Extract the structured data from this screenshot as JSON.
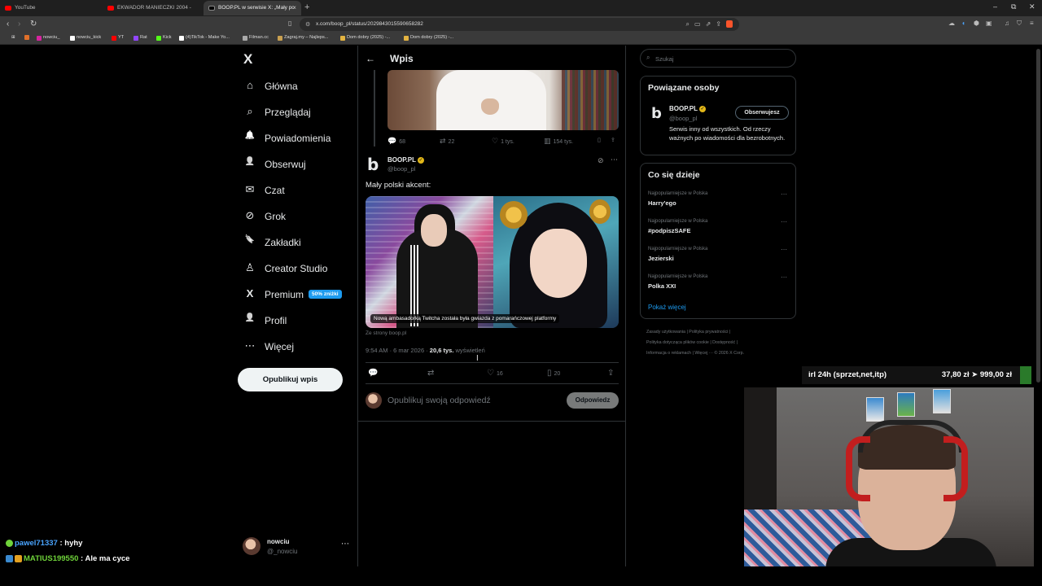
{
  "browser": {
    "tabs": [
      {
        "label": "YouTube",
        "active": false
      },
      {
        "label": "EKWADOR MANIECZKI 2004 -",
        "active": false
      },
      {
        "label": "BOOP.PL w serwisie X: „Mały po",
        "active": true
      }
    ],
    "url": "x.com/boop_pl/status/2029843015590658282",
    "bookmarks": [
      "nowciu_",
      "nowciu_kick",
      "YT",
      "Rat",
      "Kick",
      "(4)TikTok - Make Yo...",
      "Filman.cc",
      "Zagraj.my – Najleps...",
      "Dom dobry (2025) -...",
      "Dom dobry (2025) -..."
    ],
    "colors": {
      "chrome_bg": "#3a3a3a",
      "tabbar_bg": "#1f1f1f"
    }
  },
  "nav": {
    "logo": "X",
    "items": [
      {
        "label": "Główna",
        "icon": "home-icon",
        "glyph": "⌂"
      },
      {
        "label": "Przeglądaj",
        "icon": "search-icon",
        "glyph": "⌕"
      },
      {
        "label": "Powiadomienia",
        "icon": "bell-icon",
        "glyph": "🔔"
      },
      {
        "label": "Obserwuj",
        "icon": "follow-icon",
        "glyph": "👤"
      },
      {
        "label": "Czat",
        "icon": "mail-icon",
        "glyph": "✉"
      },
      {
        "label": "Grok",
        "icon": "grok-icon",
        "glyph": "⊘"
      },
      {
        "label": "Zakładki",
        "icon": "bookmark-icon",
        "glyph": "🔖"
      },
      {
        "label": "Creator Studio",
        "icon": "creator-icon",
        "glyph": "♙"
      },
      {
        "label": "Premium",
        "icon": "x-premium-icon",
        "glyph": "X"
      },
      {
        "label": "Profil",
        "icon": "profile-icon",
        "glyph": "👤"
      },
      {
        "label": "Więcej",
        "icon": "more-icon",
        "glyph": "⋯"
      }
    ],
    "premium_badge": "50% zniżki",
    "post_button": "Opublikuj wpis",
    "account": {
      "name": "nowciu",
      "handle": "@_nowciu"
    }
  },
  "main": {
    "header_title": "Wpis",
    "prev_post_actions": {
      "replies": "68",
      "reposts": "22",
      "likes": "1 tys.",
      "views": "154 tys."
    },
    "post": {
      "author": "BOOP.PL",
      "handle": "@boop_pl",
      "text": "Mały polski akcent:",
      "image_caption": "Nową ambasadorką Twitcha została była gwiazda z pomarańczowej platformy",
      "source": "Ze strony boop.pl",
      "time": "9:54 AM · 6 mar 2026 · ",
      "views_count": "20,6 tys.",
      "views_label": " wyświetleń",
      "actions": {
        "replies": "",
        "reposts": "",
        "likes": "16",
        "bookmarks": "20"
      }
    },
    "reply": {
      "placeholder": "Opublikuj swoją odpowiedź",
      "button": "Odpowiedz"
    }
  },
  "sidebar": {
    "search_placeholder": "Szukaj",
    "related": {
      "title": "Powiązane osoby",
      "name": "BOOP.PL",
      "handle": "@boop_pl",
      "bio": "Serwis inny od wszystkich. Od rzeczy ważnych po wiadomości dla bezrobotnych.",
      "follow_button": "Obserwujesz"
    },
    "trends": {
      "title": "Co się dzieje",
      "items": [
        {
          "context": "Najpopularniejsze w Polska",
          "name": "Harry'ego"
        },
        {
          "context": "Najpopularniejsze w Polska",
          "name": "#podpiszSAFE"
        },
        {
          "context": "Najpopularniejsze w Polska",
          "name": "Jezierski"
        },
        {
          "context": "Najpopularniejsze w Polska",
          "name": "Polka XXI"
        }
      ],
      "show_more": "Pokaż więcej"
    },
    "footer": {
      "line1": "Zasady użytkowania  |  Polityka prywatności  |",
      "line2": "Polityka dotycząca plików cookie  |  Dostępność  |",
      "line3": "Informacja o reklamach  |  Więcej ···  © 2026 X Corp."
    }
  },
  "overlay": {
    "ticker_left": "irl 24h (sprzet,net,itp)",
    "ticker_right": "37,80 zł  ➤  999,00 zł",
    "chat": [
      {
        "user": "pawel71337",
        "message": " : hyhy"
      },
      {
        "user": "MATIUS199550",
        "message": " : Ale ma cyce"
      }
    ]
  }
}
